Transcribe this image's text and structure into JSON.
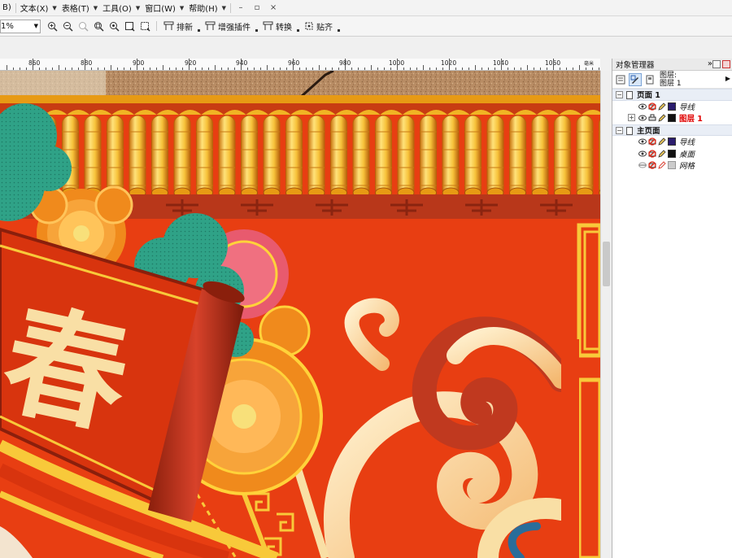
{
  "menubar": {
    "items": [
      {
        "label": "B)"
      },
      {
        "label": "文本(X)"
      },
      {
        "label": "表格(T)"
      },
      {
        "label": "工具(O)"
      },
      {
        "label": "窗口(W)"
      },
      {
        "label": "帮助(H)"
      }
    ],
    "win_controls": [
      "–",
      "▫",
      "×"
    ]
  },
  "toolbar": {
    "zoom_value": "1%",
    "zoom_icons": [
      "zoom-in-icon",
      "zoom-out-icon",
      "zoom-disabled-icon",
      "zoom-selected-icon",
      "zoom-all-icon",
      "zoom-page-icon",
      "zoom-width-icon"
    ],
    "groups": [
      {
        "label": "排新"
      },
      {
        "label": "增强插件"
      },
      {
        "label": "转换"
      },
      {
        "label": "贴齐"
      }
    ]
  },
  "ruler": {
    "labels": [
      "860",
      "880",
      "900",
      "920",
      "940",
      "960",
      "980",
      "1000",
      "1020",
      "1040",
      "1060"
    ],
    "unit": "毫米"
  },
  "canvas": {
    "banner_text": "春",
    "colors": {
      "background": "#e83e12",
      "banner_red": "#d8340e",
      "gold": "#f8c93a",
      "cream": "#f9dfa5",
      "teal": "#2fa287",
      "pink": "#e85a6e",
      "orange": "#f08a1c",
      "beam_gold": "#f0b424"
    }
  },
  "object_manager": {
    "title": "对象管理器",
    "layer_info_label": "图层:",
    "layer_info_value": "图层 1",
    "pages": [
      {
        "label": "页面 1",
        "layers": [
          {
            "name": "导线",
            "color": "#2b1d6e",
            "active": false
          },
          {
            "name": "图层 1",
            "color": "#111111",
            "active": true
          }
        ]
      },
      {
        "label": "主页面",
        "layers": [
          {
            "name": "导线",
            "color": "#2b1d6e",
            "active": false
          },
          {
            "name": "桌面",
            "color": "#111111",
            "active": false
          },
          {
            "name": "网格",
            "color": "#cccccc",
            "active": false
          }
        ]
      }
    ]
  }
}
